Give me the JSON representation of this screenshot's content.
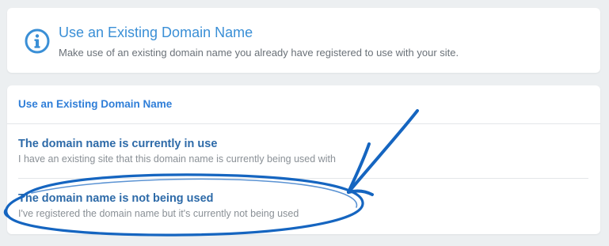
{
  "info_card": {
    "icon": "info-icon",
    "title": "Use an Existing Domain Name",
    "description": "Make use of an existing domain name you already have registered to use with your site."
  },
  "options_card": {
    "header": "Use an Existing Domain Name",
    "options": [
      {
        "title": "The domain name is currently in use",
        "description": "I have an existing site that this domain name is currently being used with"
      },
      {
        "title": "The domain name is not being used",
        "description": "I've registered the domain name but it's currently not being used"
      }
    ]
  },
  "colors": {
    "accent": "#3a8fd6",
    "option_title": "#2d6aa8",
    "annotation_ink": "#1565c0"
  }
}
